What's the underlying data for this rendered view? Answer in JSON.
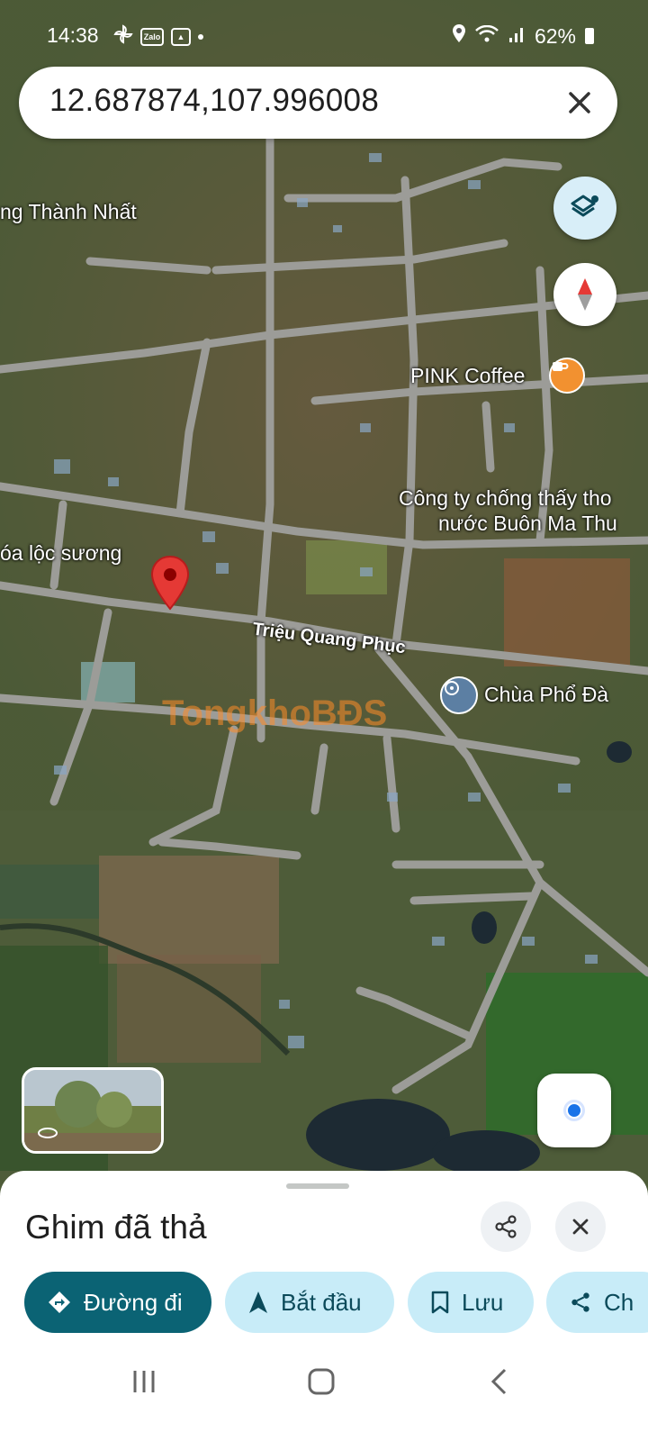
{
  "status": {
    "time": "14:38",
    "battery": "62%",
    "zalo_label": "Zalo"
  },
  "search": {
    "query": "12.687874,107.996008"
  },
  "map": {
    "labels": [
      {
        "text": "ng Thành Nhất"
      },
      {
        "text": "PINK Coffee"
      },
      {
        "text": "Công ty chống thấy tho"
      },
      {
        "text": "nước Buôn Ma Thu"
      },
      {
        "text": "óa lộc sương"
      },
      {
        "text": "Chùa Phổ Đà"
      }
    ],
    "road": "Triệu Quang Phục",
    "watermark": "TongkhoBĐS",
    "pin_color": "#e53935"
  },
  "sheet": {
    "title": "Ghim đã thả",
    "actions": [
      {
        "label": "Đường đi",
        "icon": "directions-icon"
      },
      {
        "label": "Bắt đầu",
        "icon": "navigate-icon"
      },
      {
        "label": "Lưu",
        "icon": "bookmark-icon"
      },
      {
        "label": "Ch",
        "icon": "share-icon"
      }
    ]
  },
  "colors": {
    "accent": "#0b6374",
    "chip": "#c8ecf8"
  }
}
